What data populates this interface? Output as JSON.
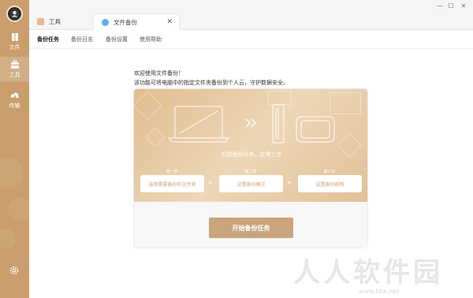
{
  "sidebar": {
    "items": [
      {
        "label": "文件",
        "icon": "file-icon"
      },
      {
        "label": "工具",
        "icon": "toolbox-icon"
      },
      {
        "label": "传输",
        "icon": "cloud-transfer-icon"
      }
    ],
    "active_index": 1,
    "settings_icon": "gear-icon",
    "bg_color": "#c99e6c"
  },
  "tabs": [
    {
      "label": "工具",
      "icon": "toolbox-icon"
    },
    {
      "label": "文件备份",
      "icon": "backup-icon",
      "close": "✕"
    }
  ],
  "window_controls": {
    "minimize": "—",
    "maximize": "☐",
    "close": "✕"
  },
  "subnav": {
    "items": [
      "备份任务",
      "备份日志",
      "备份设置",
      "使用帮助"
    ],
    "active_index": 0
  },
  "content": {
    "welcome": "欢迎使用文件备份！",
    "description": "该功能可将电脑中的指定文件夹备份到个人云，守护数据安全。",
    "banner_title": "创建备份任务，仅需三步",
    "steps": [
      {
        "step_label": "第一步",
        "text": "选择需要备份的文件夹"
      },
      {
        "step_label": "第二步",
        "text": "设置备份模式"
      },
      {
        "step_label": "第三步",
        "text": "设置备份规则"
      }
    ],
    "step_arrow": "»",
    "start_button": "开始备份任务"
  },
  "watermark": {
    "text": "人人软件园",
    "url": "www.kkx.net"
  },
  "colors": {
    "accent": "#c8a57c",
    "banner_start": "#e0bd8f",
    "banner_mid": "#edd6b6"
  }
}
